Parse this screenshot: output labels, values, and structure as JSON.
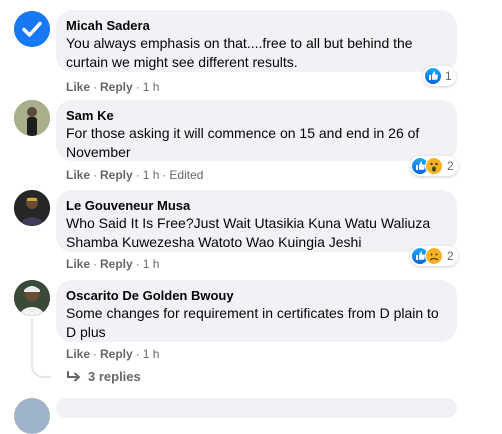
{
  "comments": [
    {
      "author": "Micah Sadera",
      "line1": "You always emphasis on that....free to all but behind the",
      "line2": "curtain we might see different results.",
      "like": "Like",
      "reply": "Reply",
      "time": "1 h",
      "edited": "",
      "reaction_count": "1"
    },
    {
      "author": "Sam Ke",
      "line1": "For those asking it will commence on 15 and end in 26 of",
      "line2": "November",
      "like": "Like",
      "reply": "Reply",
      "time": "1 h",
      "edited": "Edited",
      "reaction_count": "2"
    },
    {
      "author": "Le Gouveneur Musa",
      "line1": "Who Said It Is Free?Just Wait Utasikia Kuna Watu Waliuza",
      "line2": "Shamba Kuwezesha Watoto Wao Kuingia Jeshi",
      "like": "Like",
      "reply": "Reply",
      "time": "1 h",
      "edited": "",
      "reaction_count": "2"
    },
    {
      "author": "Oscarito De Golden Bwouy",
      "line1": "Some changes for requirement in certificates from D plain to",
      "line2": "D plus",
      "like": "Like",
      "reply": "Reply",
      "time": "1 h",
      "edited": "",
      "reaction_count": ""
    }
  ],
  "view_replies": "3 replies",
  "colors": {
    "like_blue": "#1877f2",
    "bubble": "#f0f2f5",
    "meta": "#65676b"
  },
  "icons": [
    "verified-check-icon",
    "like-reaction-icon",
    "wow-reaction-icon",
    "care-reaction-icon",
    "reply-arrow-icon"
  ]
}
